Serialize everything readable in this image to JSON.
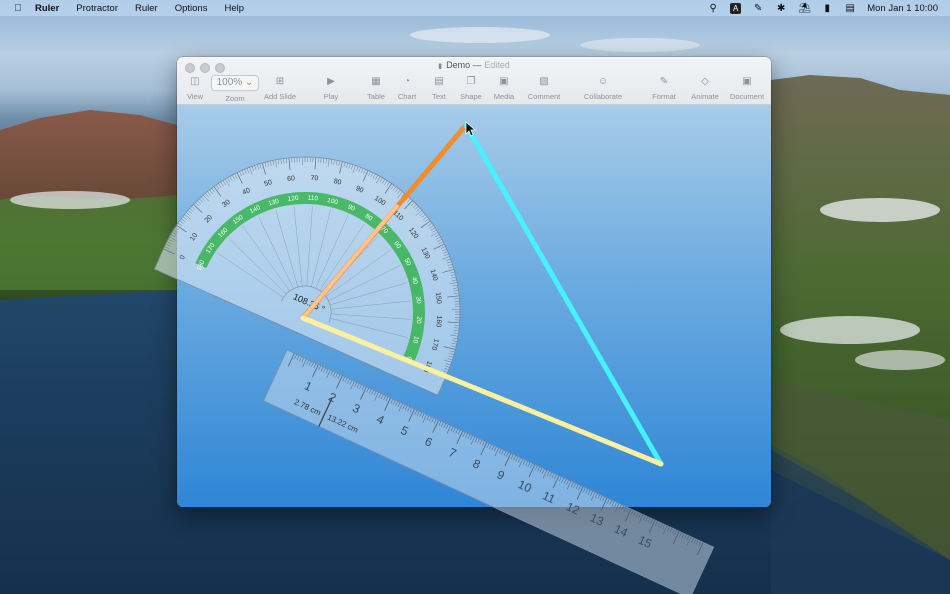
{
  "menubar": {
    "apple_icon": "apple-logo",
    "menus": [
      "Ruler",
      "Protractor",
      "Ruler",
      "Options",
      "Help"
    ],
    "clock": "Mon Jan 1  10:00",
    "status_icons": [
      "search-icon",
      "input-source-icon",
      "pen-icon",
      "bluetooth-icon",
      "wifi-icon",
      "battery-icon",
      "control-center-icon"
    ]
  },
  "window": {
    "title": "Demo",
    "separator": "—",
    "status": "Edited",
    "zoom_value": "100%",
    "toolbar": [
      {
        "label": "View",
        "icon": "sidebar-icon"
      },
      {
        "label": "Zoom",
        "icon": "zoom-select"
      },
      {
        "label": "Add Slide",
        "icon": "add-slide-icon"
      },
      {
        "label": "Play",
        "icon": "play-icon"
      },
      {
        "label": "Table",
        "icon": "table-icon"
      },
      {
        "label": "Chart",
        "icon": "chart-icon"
      },
      {
        "label": "Text",
        "icon": "text-icon"
      },
      {
        "label": "Shape",
        "icon": "shape-icon"
      },
      {
        "label": "Media",
        "icon": "media-icon"
      },
      {
        "label": "Comment",
        "icon": "comment-icon"
      },
      {
        "label": "Collaborate",
        "icon": "collaborate-icon"
      },
      {
        "label": "Format",
        "icon": "format-icon"
      },
      {
        "label": "Animate",
        "icon": "animate-icon"
      },
      {
        "label": "Document",
        "icon": "document-icon"
      }
    ]
  },
  "protractor": {
    "angle_readout": "108.35 °",
    "outer_labels": [
      "0",
      "10",
      "20",
      "30",
      "40",
      "50",
      "60",
      "70",
      "80",
      "90",
      "100",
      "110",
      "120",
      "130",
      "140",
      "150",
      "160",
      "170",
      "180"
    ],
    "inner_labels": [
      "180",
      "170",
      "160",
      "150",
      "140",
      "130",
      "120",
      "110",
      "100",
      "90",
      "80",
      "70",
      "60",
      "50",
      "40",
      "30",
      "20",
      "10",
      "0"
    ]
  },
  "ruler": {
    "numbers": [
      "1",
      "2",
      "3",
      "4",
      "5",
      "6",
      "7",
      "8",
      "9",
      "10",
      "11",
      "12",
      "13",
      "14",
      "15"
    ],
    "measure_a": "2.78 cm",
    "measure_b": "13.22 cm"
  },
  "colors": {
    "line_orange": "#f28c2c",
    "line_cyan": "#46f2ff",
    "line_yellow": "#fff0a0",
    "arc_green": "#3db55a"
  }
}
